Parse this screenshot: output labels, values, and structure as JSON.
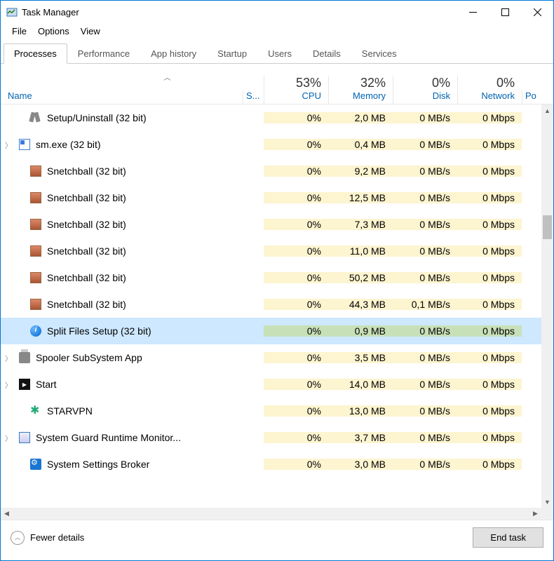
{
  "window": {
    "title": "Task Manager"
  },
  "menu": {
    "file": "File",
    "options": "Options",
    "view": "View"
  },
  "tabs": {
    "processes": "Processes",
    "performance": "Performance",
    "apphistory": "App history",
    "startup": "Startup",
    "users": "Users",
    "details": "Details",
    "services": "Services"
  },
  "columns": {
    "name": "Name",
    "status": "S...",
    "cpu_pct": "53%",
    "cpu": "CPU",
    "mem_pct": "32%",
    "mem": "Memory",
    "disk_pct": "0%",
    "disk": "Disk",
    "net_pct": "0%",
    "net": "Network",
    "power": "Po"
  },
  "rows": [
    {
      "indent": true,
      "icon": "tools",
      "name": "Setup/Uninstall (32 bit)",
      "cpu": "0%",
      "mem": "2,0 MB",
      "disk": "0 MB/s",
      "net": "0 Mbps"
    },
    {
      "expand": true,
      "icon": "win",
      "name": "sm.exe (32 bit)",
      "cpu": "0%",
      "mem": "0,4 MB",
      "disk": "0 MB/s",
      "net": "0 Mbps"
    },
    {
      "indent": true,
      "icon": "game",
      "name": "Snetchball (32 bit)",
      "cpu": "0%",
      "mem": "9,2 MB",
      "disk": "0 MB/s",
      "net": "0 Mbps"
    },
    {
      "indent": true,
      "icon": "game",
      "name": "Snetchball (32 bit)",
      "cpu": "0%",
      "mem": "12,5 MB",
      "disk": "0 MB/s",
      "net": "0 Mbps"
    },
    {
      "indent": true,
      "icon": "game",
      "name": "Snetchball (32 bit)",
      "cpu": "0%",
      "mem": "7,3 MB",
      "disk": "0 MB/s",
      "net": "0 Mbps"
    },
    {
      "indent": true,
      "icon": "game",
      "name": "Snetchball (32 bit)",
      "cpu": "0%",
      "mem": "11,0 MB",
      "disk": "0 MB/s",
      "net": "0 Mbps"
    },
    {
      "indent": true,
      "icon": "game",
      "name": "Snetchball (32 bit)",
      "cpu": "0%",
      "mem": "50,2 MB",
      "disk": "0 MB/s",
      "net": "0 Mbps"
    },
    {
      "indent": true,
      "icon": "game",
      "name": "Snetchball (32 bit)",
      "cpu": "0%",
      "mem": "44,3 MB",
      "disk": "0,1 MB/s",
      "net": "0 Mbps"
    },
    {
      "indent": true,
      "icon": "info",
      "name": "Split Files Setup (32 bit)",
      "cpu": "0%",
      "mem": "0,9 MB",
      "disk": "0 MB/s",
      "net": "0 Mbps",
      "selected": true
    },
    {
      "expand": true,
      "icon": "printer",
      "name": "Spooler SubSystem App",
      "cpu": "0%",
      "mem": "3,5 MB",
      "disk": "0 MB/s",
      "net": "0 Mbps"
    },
    {
      "expand": true,
      "icon": "start",
      "name": "Start",
      "cpu": "0%",
      "mem": "14,0 MB",
      "disk": "0 MB/s",
      "net": "0 Mbps"
    },
    {
      "indent": true,
      "icon": "star",
      "name": "STARVPN",
      "cpu": "0%",
      "mem": "13,0 MB",
      "disk": "0 MB/s",
      "net": "0 Mbps"
    },
    {
      "expand": true,
      "icon": "shield",
      "name": "System Guard Runtime Monitor...",
      "cpu": "0%",
      "mem": "3,7 MB",
      "disk": "0 MB/s",
      "net": "0 Mbps"
    },
    {
      "indent": true,
      "icon": "gear",
      "name": "System Settings Broker",
      "cpu": "0%",
      "mem": "3,0 MB",
      "disk": "0 MB/s",
      "net": "0 Mbps"
    }
  ],
  "footer": {
    "fewer": "Fewer details",
    "endtask": "End task"
  }
}
